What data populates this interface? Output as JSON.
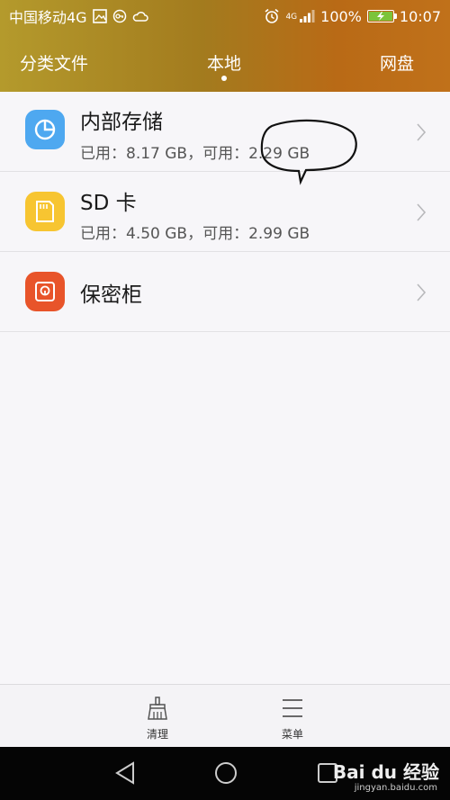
{
  "status_bar": {
    "carrier": "中国移动4G",
    "network_badge": "4G",
    "battery_percent": "100%",
    "time": "10:07",
    "battery_level": 1.0,
    "icons": [
      "image-icon",
      "vpn-icon",
      "cloud-icon",
      "alarm-icon",
      "signal-icon",
      "battery-icon"
    ]
  },
  "tabs": [
    {
      "label": "分类文件",
      "active": false
    },
    {
      "label": "本地",
      "active": true
    },
    {
      "label": "网盘",
      "active": false
    }
  ],
  "storage_list": [
    {
      "title": "内部存储",
      "subtitle": "已用：8.17 GB，可用：2.29 GB",
      "icon": "pie-chart-icon",
      "icon_color": "#4ea8f0"
    },
    {
      "title": "SD 卡",
      "subtitle": "已用：4.50 GB，可用：2.99 GB",
      "icon": "sd-card-icon",
      "icon_color": "#f7c531"
    },
    {
      "title": "保密柜",
      "subtitle": "",
      "icon": "safe-icon",
      "icon_color": "#e8542a"
    }
  ],
  "toolbar": {
    "clean_label": "清理",
    "menu_label": "菜单"
  },
  "watermark": {
    "brand": "Bai du 经验",
    "url": "jingyan.baidu.com"
  },
  "colors": {
    "header_start": "#b49a2c",
    "header_end": "#c0711a",
    "background": "#f7f6f9",
    "navbar": "#050505"
  }
}
